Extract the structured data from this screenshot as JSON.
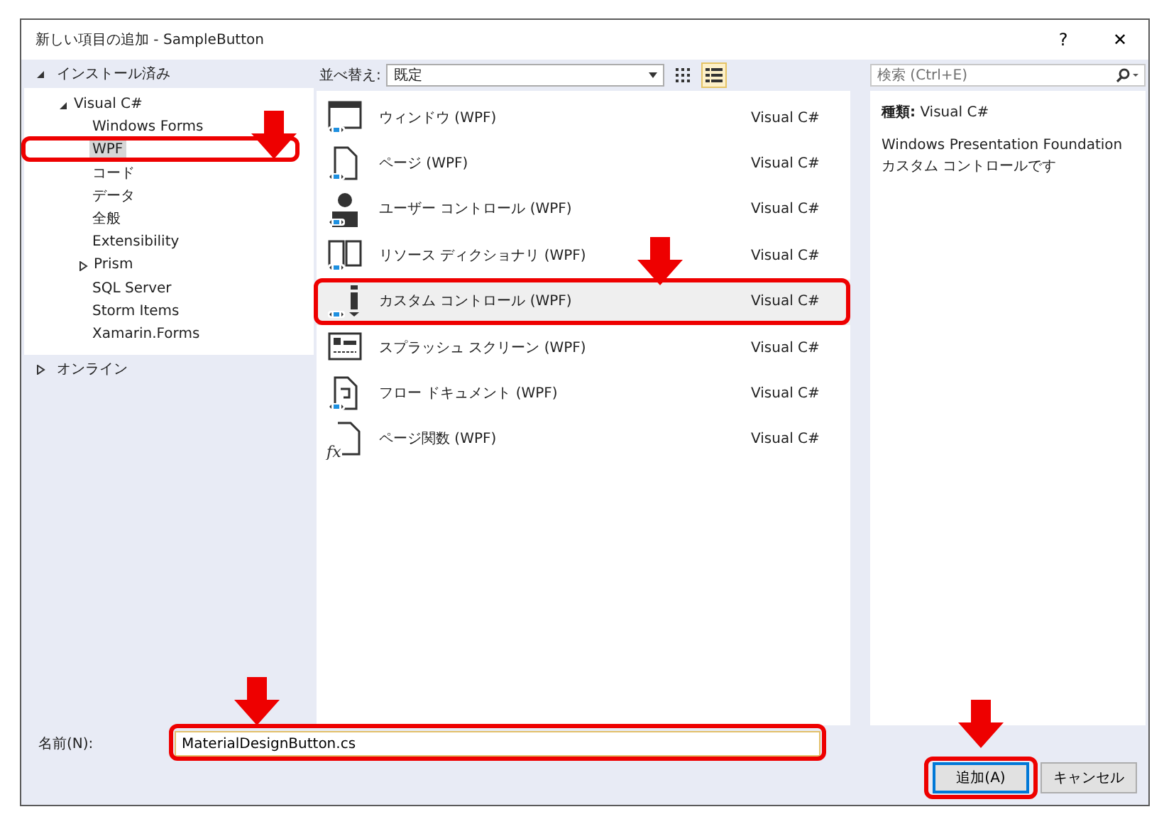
{
  "window": {
    "title": "新しい項目の追加 - SampleButton",
    "buttons": [
      "?",
      "✕"
    ]
  },
  "sidebar": {
    "sections": [
      {
        "label": "インストール済み",
        "expanded": true,
        "tree": [
          {
            "label": "Visual C#",
            "expanded": true,
            "selected": false,
            "children": [
              {
                "label": "Windows Forms",
                "selected": false
              },
              {
                "label": "WPF",
                "selected": true,
                "callout": true
              },
              {
                "label": "コード",
                "selected": false
              },
              {
                "label": "データ",
                "selected": false
              },
              {
                "label": "全般",
                "selected": false
              },
              {
                "label": "Extensibility",
                "selected": false
              },
              {
                "label": "Prism",
                "selected": false,
                "expanded": false
              },
              {
                "label": "SQL Server",
                "selected": false
              },
              {
                "label": "Storm Items",
                "selected": false
              },
              {
                "label": "Xamarin.Forms",
                "selected": false
              }
            ]
          }
        ]
      },
      {
        "label": "オンライン",
        "expanded": false
      }
    ]
  },
  "toolbar": {
    "sort_label": "並べ替え:",
    "sort_value": "既定",
    "views": [
      {
        "kind": "grid",
        "selected": false
      },
      {
        "kind": "list",
        "selected": true
      }
    ]
  },
  "search": {
    "placeholder": "検索 (Ctrl+E)"
  },
  "templates": [
    {
      "kind": "window",
      "name": "ウィンドウ (WPF)",
      "language": "Visual C#",
      "selected": false
    },
    {
      "kind": "page",
      "name": "ページ (WPF)",
      "language": "Visual C#",
      "selected": false
    },
    {
      "kind": "user",
      "name": "ユーザー コントロール (WPF)",
      "language": "Visual C#",
      "selected": false
    },
    {
      "kind": "dictionary",
      "name": "リソース ディクショナリ (WPF)",
      "language": "Visual C#",
      "selected": false
    },
    {
      "kind": "control",
      "name": "カスタム コントロール (WPF)",
      "language": "Visual C#",
      "selected": true,
      "callout": true
    },
    {
      "kind": "splash",
      "name": "スプラッシュ スクリーン (WPF)",
      "language": "Visual C#",
      "selected": false
    },
    {
      "kind": "flow",
      "name": "フロー ドキュメント (WPF)",
      "language": "Visual C#",
      "selected": false
    },
    {
      "kind": "function",
      "icon_text": "fx",
      "name": "ページ関数 (WPF)",
      "language": "Visual C#",
      "selected": false
    }
  ],
  "details": {
    "type_label": "種類:",
    "type_value": "Visual C#",
    "description": "Windows Presentation Foundation カスタム コントロールです"
  },
  "name_field": {
    "label": "名前(N):",
    "value": "MaterialDesignButton.cs",
    "callout": true
  },
  "buttons": [
    {
      "label": "追加(A)",
      "default": true,
      "callout": true
    },
    {
      "label": "キャンセル",
      "default": false,
      "callout": false
    }
  ]
}
